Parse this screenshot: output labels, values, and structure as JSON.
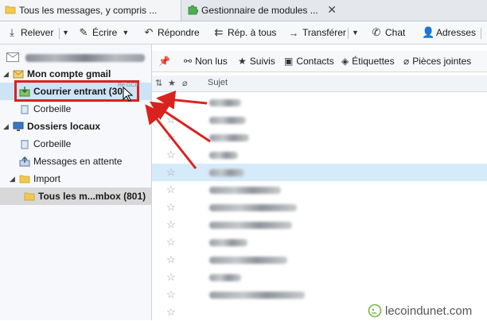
{
  "tabs": [
    {
      "label": "Tous les messages, y compris ...",
      "active": true
    },
    {
      "label": "Gestionnaire de modules ...",
      "close": "✕"
    }
  ],
  "toolbar": {
    "items": [
      "Relever",
      "Écrire",
      "Répondre",
      "Rép. à tous",
      "Transférer",
      "Chat",
      "Adresses"
    ]
  },
  "folders": {
    "account_gmail": "Mon compte gmail",
    "inbox": "Courrier entrant (30)",
    "trash_gmail": "Corbeille",
    "local": "Dossiers locaux",
    "trash_local": "Corbeille",
    "outbox": "Messages en attente",
    "import": "Import",
    "import_sub": "Tous les m...mbox (801)"
  },
  "filters": [
    "Non lus",
    "Suivis",
    "Contacts",
    "Étiquettes",
    "Pièces jointes"
  ],
  "columns": {
    "subject": "Sujet"
  },
  "colors": {
    "accent_red": "#d9231f",
    "selection": "#cde4f7"
  },
  "watermark": "lecoindunet.com"
}
